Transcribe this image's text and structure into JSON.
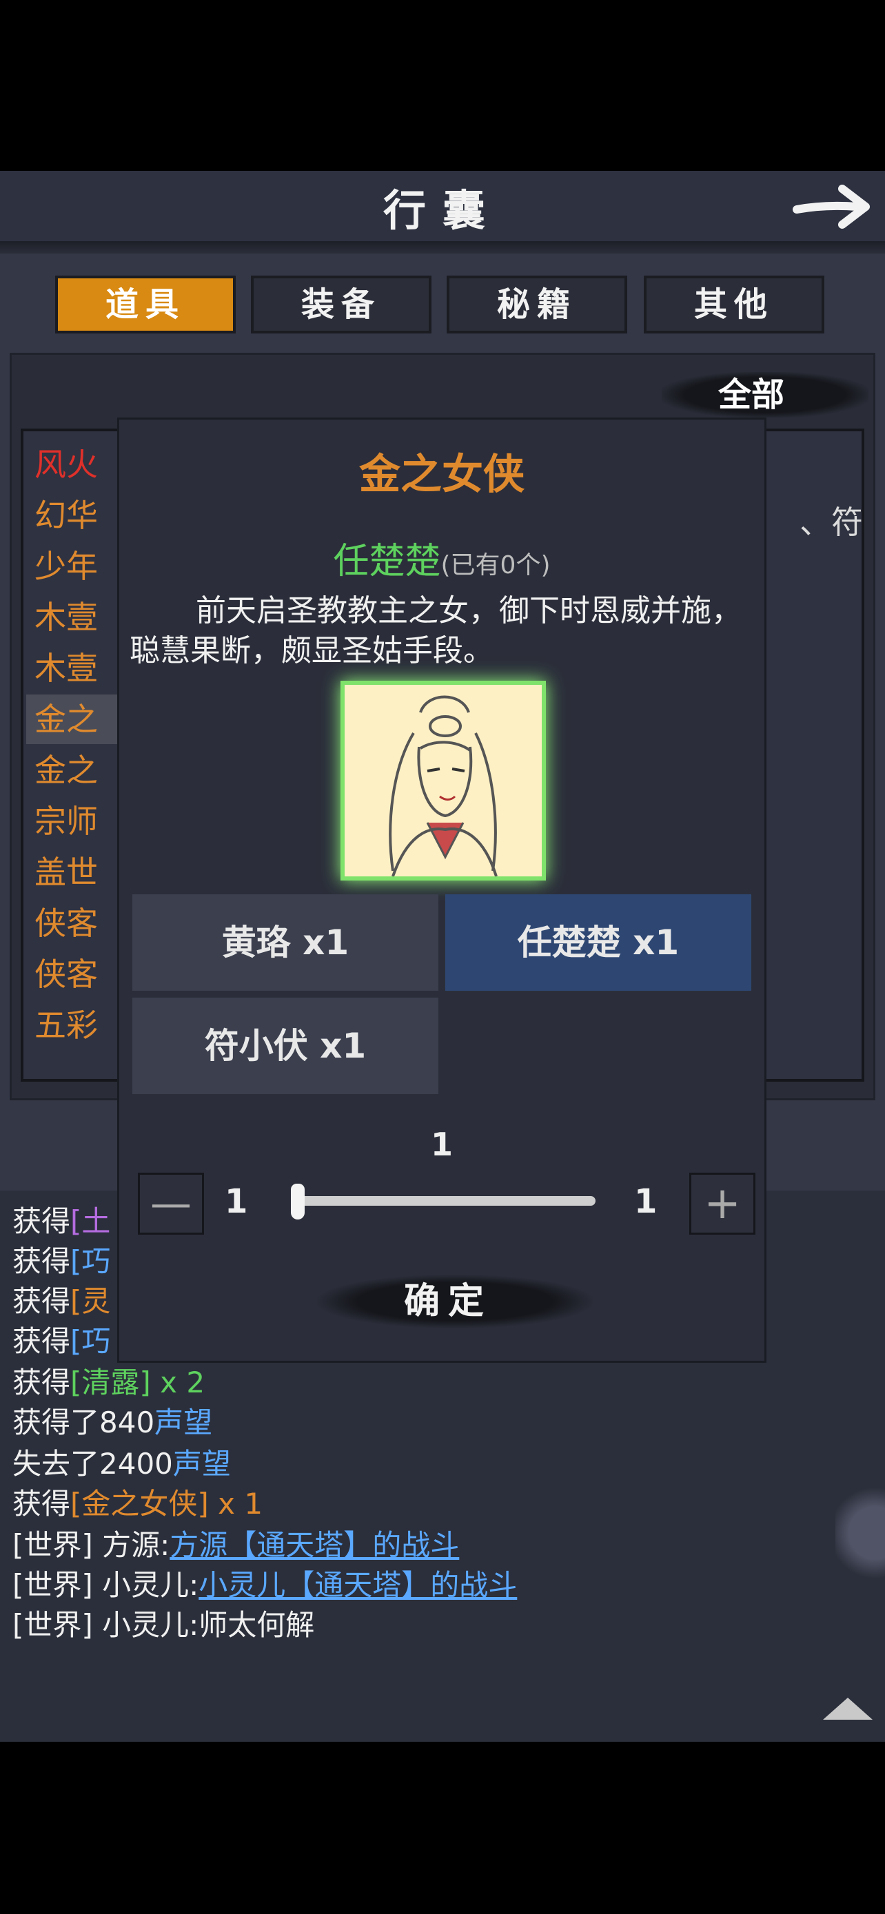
{
  "header": {
    "title": "行囊"
  },
  "tabs": [
    {
      "label": "道具",
      "active": true
    },
    {
      "label": "装备",
      "active": false
    },
    {
      "label": "秘籍",
      "active": false
    },
    {
      "label": "其他",
      "active": false
    }
  ],
  "filter": {
    "label": "全部"
  },
  "item_list": [
    {
      "label": "风火",
      "color": "#e0302a"
    },
    {
      "label": "幻华",
      "color": "#e08a2e"
    },
    {
      "label": "少年",
      "color": "#e08a2e"
    },
    {
      "label": "木壹",
      "color": "#e08a2e"
    },
    {
      "label": "木壹",
      "color": "#e08a2e"
    },
    {
      "label": "金之",
      "color": "#e08a2e",
      "selected": true
    },
    {
      "label": "金之",
      "color": "#e08a2e"
    },
    {
      "label": "宗师",
      "color": "#e08a2e"
    },
    {
      "label": "盖世",
      "color": "#e08a2e"
    },
    {
      "label": "侠客",
      "color": "#e08a2e"
    },
    {
      "label": "侠客",
      "color": "#e08a2e"
    },
    {
      "label": "五彩",
      "color": "#e08a2e"
    }
  ],
  "list_right_snippet": "、符",
  "modal": {
    "title": "金之女侠",
    "character_name": "任楚楚",
    "owned_text": "(已有0个)",
    "description": "前天启圣教教主之女，御下时恩威并施，聪慧果断，颇显圣姑手段。",
    "options": [
      {
        "label": "黄珞 x1",
        "active": false
      },
      {
        "label": "任楚楚 x1",
        "active": true
      },
      {
        "label": "符小伏 x1",
        "active": false
      }
    ],
    "quantity": {
      "value": "1",
      "min": "1",
      "max": "1",
      "minus_icon": "minus-icon",
      "plus_icon": "plus-icon"
    },
    "confirm_label": "确定"
  },
  "log": [
    {
      "prefix": "获得",
      "item": "[土",
      "item_class": "c-purple"
    },
    {
      "prefix": "获得",
      "item": "[巧",
      "item_class": "c-blue"
    },
    {
      "prefix": "获得",
      "item": "[灵",
      "item_class": "c-orange"
    },
    {
      "prefix": "获得",
      "item": "[巧",
      "item_class": "c-blue"
    },
    {
      "prefix": "获得",
      "item": "[清露] x 2",
      "item_class": "c-green"
    },
    {
      "prefix": "获得了840",
      "item": "声望",
      "item_class": "c-blue"
    },
    {
      "prefix": "失去了2400",
      "item": "声望",
      "item_class": "c-blue"
    },
    {
      "prefix": "获得",
      "item": "[金之女侠] x 1",
      "item_class": "c-orange"
    },
    {
      "prefix": "[世界] 方源:",
      "item": "方源【通天塔】的战斗",
      "item_class": "c-link"
    },
    {
      "prefix": "[世界] 小灵儿:",
      "item": "小灵儿【通天塔】的战斗",
      "item_class": "c-link"
    },
    {
      "prefix": "[世界] 小灵儿:师太何解",
      "item": "",
      "item_class": ""
    }
  ],
  "icons": {
    "back": "back-arrow-icon",
    "scroll_up": "scroll-up-icon"
  },
  "colors": {
    "accent": "#d88a12",
    "legendary": "#e08a2e",
    "name_green": "#5ed25e",
    "link_blue": "#5aa8ff"
  }
}
